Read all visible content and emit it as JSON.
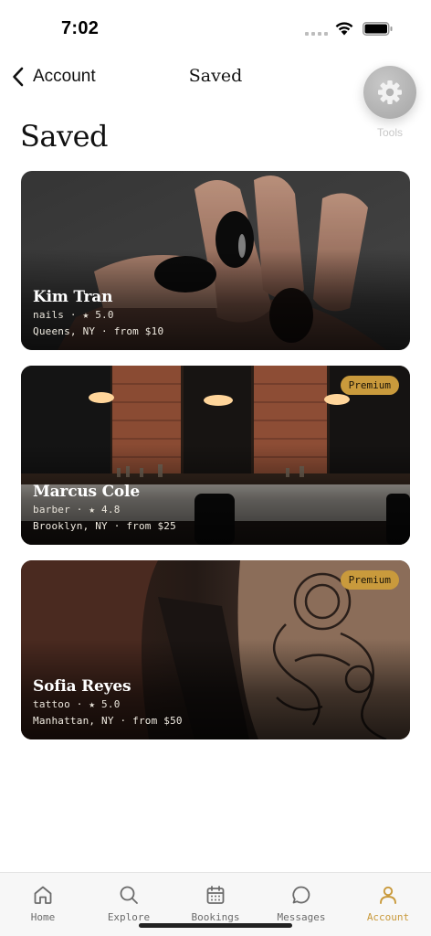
{
  "status_bar": {
    "time": "7:02"
  },
  "nav": {
    "back_label": "Account",
    "title": "Saved"
  },
  "tools": {
    "label": "Tools"
  },
  "heading": "Saved",
  "cards": [
    {
      "name": "Kim Tran",
      "meta": "nails · ★ 5.0",
      "location": "Queens, NY · from $10",
      "badge": ""
    },
    {
      "name": "Marcus Cole",
      "meta": "barber · ★ 4.8",
      "location": "Brooklyn, NY · from $25",
      "badge": "Premium"
    },
    {
      "name": "Sofia Reyes",
      "meta": "tattoo · ★ 5.0",
      "location": "Manhattan, NY · from $50",
      "badge": "Premium"
    }
  ],
  "tabbar": {
    "items": [
      {
        "label": "Home",
        "icon": "home-icon"
      },
      {
        "label": "Explore",
        "icon": "search-icon"
      },
      {
        "label": "Bookings",
        "icon": "calendar-icon"
      },
      {
        "label": "Messages",
        "icon": "chat-bubble-icon"
      },
      {
        "label": "Account",
        "icon": "person-icon"
      }
    ],
    "active": "Account"
  },
  "colors": {
    "accent": "#c99a3c",
    "fab": "#b3b3b3",
    "tab_bar_bg": "#f7f7f7"
  }
}
